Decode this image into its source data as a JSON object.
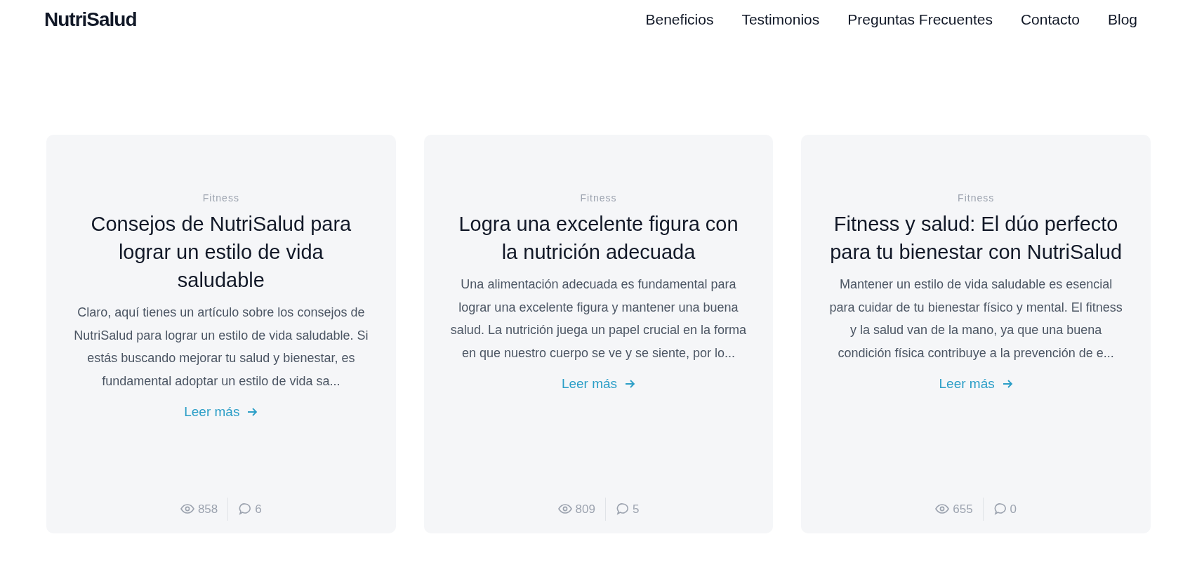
{
  "header": {
    "logo": "NutriSalud",
    "nav": [
      "Beneficios",
      "Testimonios",
      "Preguntas Frecuentes",
      "Contacto",
      "Blog"
    ]
  },
  "posts": [
    {
      "category": "Fitness",
      "title": "Consejos de NutriSalud para lograr un estilo de vida saludable",
      "excerpt": "Claro, aquí tienes un artículo sobre los consejos de NutriSalud para lograr un estilo de vida saludable. Si estás buscando mejorar tu salud y bienestar, es fundamental adoptar un estilo de vida sa...",
      "link": "Leer más",
      "views": "858",
      "comments": "6"
    },
    {
      "category": "Fitness",
      "title": "Logra una excelente figura con la nutrición adecuada",
      "excerpt": "Una alimentación adecuada es fundamental para lograr una excelente figura y mantener una buena salud. La nutrición juega un papel crucial en la forma en que nuestro cuerpo se ve y se siente, por lo...",
      "link": "Leer más",
      "views": "809",
      "comments": "5"
    },
    {
      "category": "Fitness",
      "title": "Fitness y salud: El dúo perfecto para tu bienestar con NutriSalud",
      "excerpt": "Mantener un estilo de vida saludable es esencial para cuidar de tu bienestar físico y mental. El fitness y la salud van de la mano, ya que una buena condición física contribuye a la prevención de e...",
      "link": "Leer más",
      "views": "655",
      "comments": "0"
    }
  ]
}
